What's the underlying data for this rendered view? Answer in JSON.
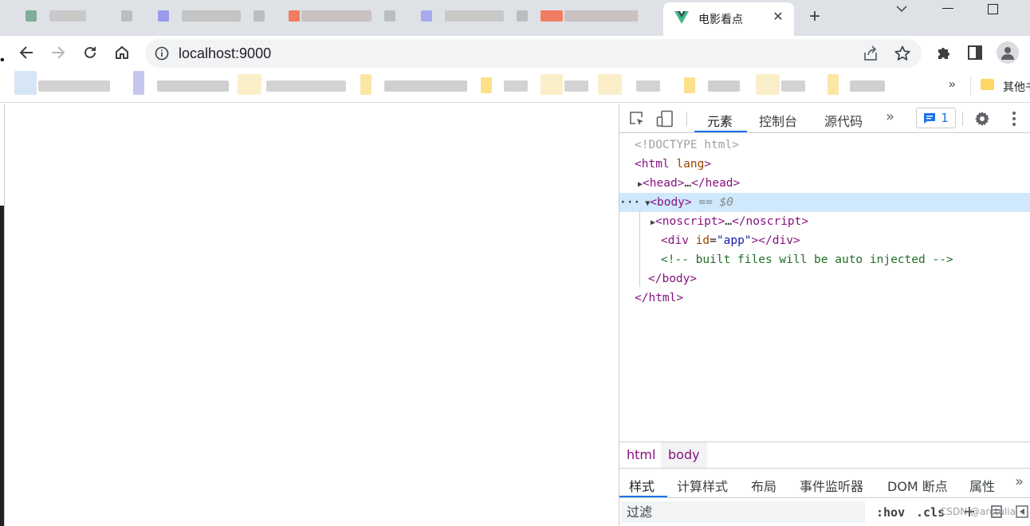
{
  "browser": {
    "active_tab": {
      "title": "电影看点"
    },
    "address_bar": {
      "url": "localhost:9000"
    },
    "bookmarks": {
      "overflow": "»",
      "other_label": "其他书签"
    }
  },
  "devtools": {
    "tabs": [
      {
        "label": "元素",
        "active": true
      },
      {
        "label": "控制台",
        "active": false
      },
      {
        "label": "源代码",
        "active": false
      }
    ],
    "more_tabs": "»",
    "issues_count": "1",
    "dom": {
      "doctype": "<!DOCTYPE html>",
      "html_open": "html",
      "html_attr": "lang",
      "head": "head",
      "head_close": "/head",
      "ellipsis": "…",
      "body": "body",
      "selected_marker": "== $0",
      "noscript": "noscript",
      "noscript_close": "/noscript",
      "div_tag": "div",
      "div_attr_name": "id",
      "div_attr_value": "\"app\"",
      "div_close": "/div",
      "comment": "<!-- built files will be auto injected -->",
      "body_close": "/body",
      "html_close": "/html"
    },
    "breadcrumbs": [
      "html",
      "body"
    ],
    "sub_tabs": [
      {
        "label": "样式",
        "active": true
      },
      {
        "label": "计算样式",
        "active": false
      },
      {
        "label": "布局",
        "active": false
      },
      {
        "label": "事件监听器",
        "active": false
      },
      {
        "label": "DOM 断点",
        "active": false
      },
      {
        "label": "属性",
        "active": false
      }
    ],
    "sub_more": "»",
    "filter": {
      "placeholder": "过滤",
      "hov": ":hov",
      "cls": ".cls"
    },
    "watermark": "CSDN @arctulia"
  },
  "colors": {
    "accent": "#1a73e8",
    "tag": "#881280",
    "attr_name": "#994500",
    "attr_value": "#1a1aa6",
    "comment": "#236e25",
    "selection": "#cfe8fc"
  }
}
